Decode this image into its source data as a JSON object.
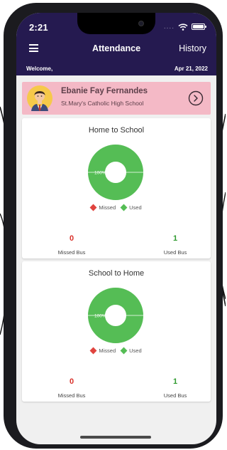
{
  "status_bar": {
    "time": "2:21",
    "signal_dots": "....",
    "icons": [
      "wifi-icon",
      "battery-icon"
    ]
  },
  "app_bar": {
    "menu_icon": "menu-icon",
    "title": "Attendance",
    "history_label": "History",
    "welcome_label": "Welcome,",
    "date": "Apr 21, 2022"
  },
  "student": {
    "name": "Ebanie Fay Fernandes",
    "school": "St.Mary's Catholic High School",
    "avatar_icon": "student-avatar-icon",
    "action_icon": "chevron-right-circle-icon"
  },
  "legend": {
    "missed": "Missed",
    "used": "Used"
  },
  "colors": {
    "header": "#251a50",
    "card_pink": "#f4b9c6",
    "used": "#55bd55",
    "missed": "#e0443f"
  },
  "trips": [
    {
      "title": "Home to School",
      "used_percent": 100,
      "used_percent_label": "100%",
      "missed_count": "0",
      "missed_label": "Missed Bus",
      "used_count": "1",
      "used_label": "Used Bus"
    },
    {
      "title": "School to Home",
      "used_percent": 100,
      "used_percent_label": "100%",
      "missed_count": "0",
      "missed_label": "Missed Bus",
      "used_count": "1",
      "used_label": "Used Bus"
    }
  ]
}
